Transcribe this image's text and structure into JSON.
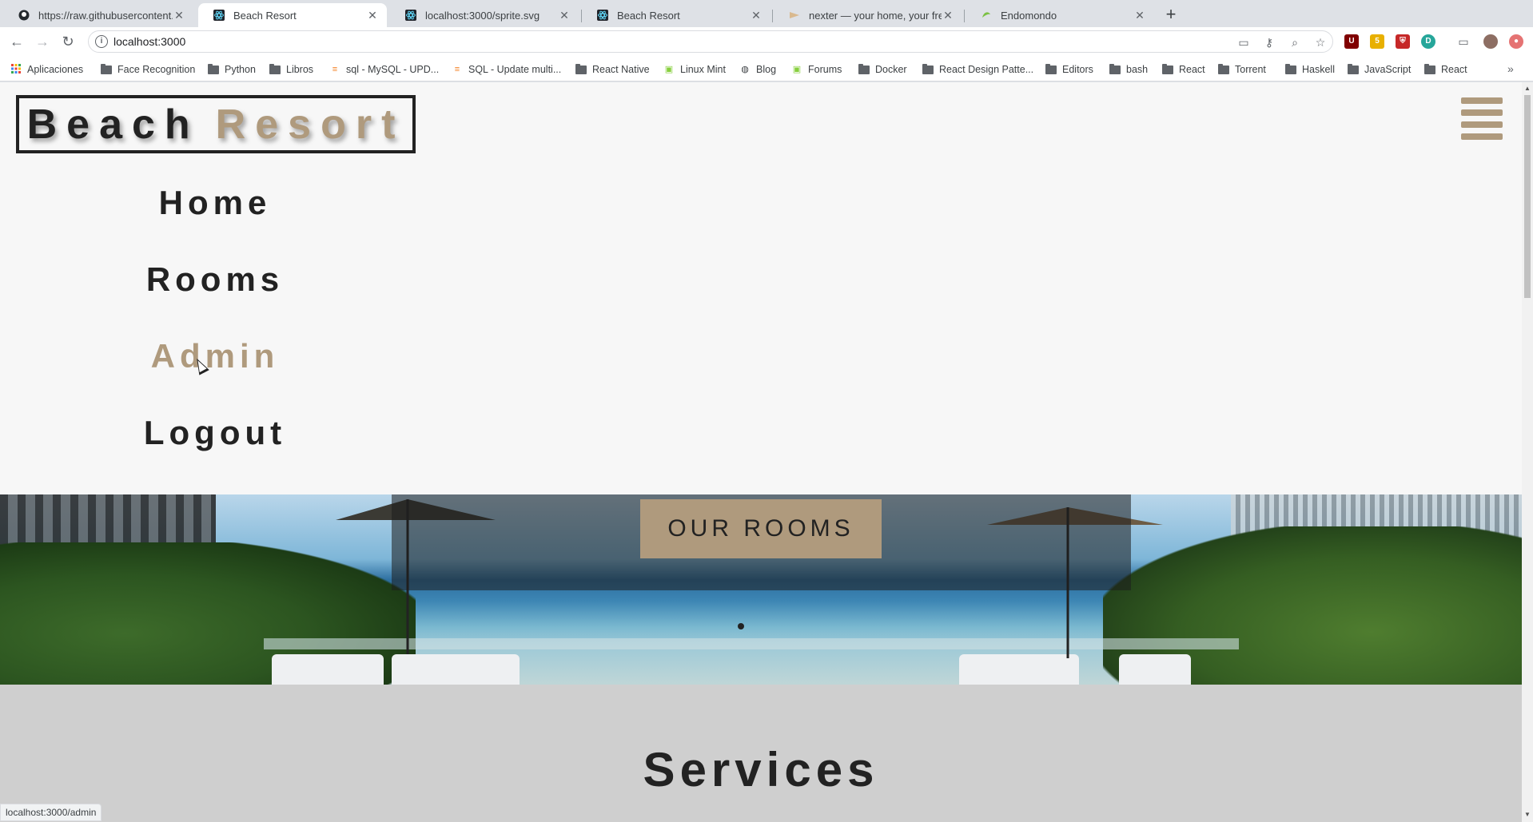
{
  "browser": {
    "tabs": [
      {
        "title": "https://raw.githubusercontent.c",
        "icon": "github-icon",
        "active": false
      },
      {
        "title": "Beach Resort",
        "icon": "react-icon",
        "active": true
      },
      {
        "title": "localhost:3000/sprite.svg",
        "icon": "react-icon",
        "active": false
      },
      {
        "title": "Beach Resort",
        "icon": "react-icon",
        "active": false
      },
      {
        "title": "nexter — your home, your free",
        "icon": "nexter-icon",
        "active": false
      },
      {
        "title": "Endomondo",
        "icon": "endomondo-icon",
        "active": false
      }
    ],
    "address": "localhost:3000",
    "status_url": "localhost:3000/admin",
    "bookmarks": [
      {
        "label": "Aplicaciones",
        "kind": "apps"
      },
      {
        "label": "Face Recognition",
        "kind": "folder"
      },
      {
        "label": "Python",
        "kind": "folder"
      },
      {
        "label": "Libros",
        "kind": "folder"
      },
      {
        "label": "sql - MySQL - UPD...",
        "kind": "stackoverflow"
      },
      {
        "label": "SQL - Update multi...",
        "kind": "stackoverflow"
      },
      {
        "label": "React Native",
        "kind": "folder"
      },
      {
        "label": "Linux Mint",
        "kind": "mint"
      },
      {
        "label": "Blog",
        "kind": "globe"
      },
      {
        "label": "Forums",
        "kind": "mint"
      },
      {
        "label": "Docker",
        "kind": "folder"
      },
      {
        "label": "React Design Patte...",
        "kind": "folder"
      },
      {
        "label": "Editors",
        "kind": "folder"
      },
      {
        "label": "bash",
        "kind": "folder"
      },
      {
        "label": "React",
        "kind": "folder"
      },
      {
        "label": "Torrent",
        "kind": "folder"
      },
      {
        "label": "Haskell",
        "kind": "folder"
      },
      {
        "label": "JavaScript",
        "kind": "folder"
      },
      {
        "label": "React",
        "kind": "folder"
      }
    ]
  },
  "page": {
    "logo": {
      "word1": "Beach",
      "word2": "Resort"
    },
    "nav": [
      "Home",
      "Rooms",
      "Admin",
      "Logout"
    ],
    "active_nav": "Admin",
    "hero_button": "OUR ROOMS",
    "services_title": "Services"
  },
  "colors": {
    "accent": "#af9a7d",
    "text": "#222222",
    "page_bg": "#f7f7f7",
    "services_bg": "#cfcfcf"
  }
}
